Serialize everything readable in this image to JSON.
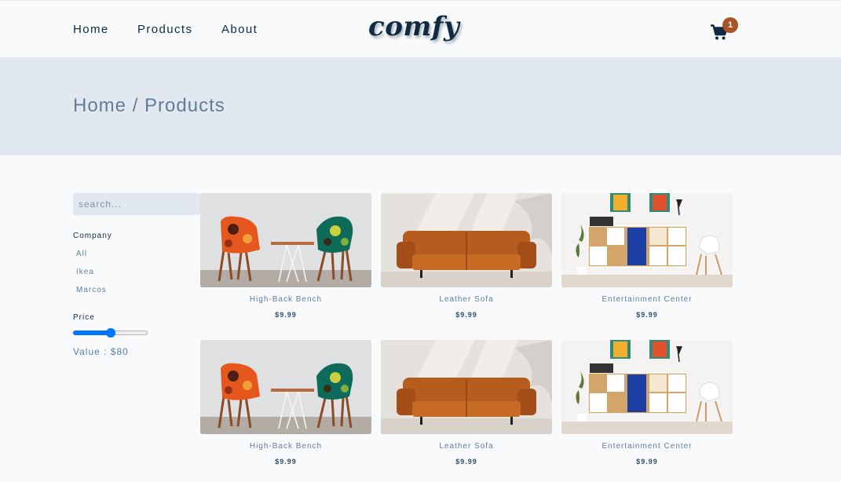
{
  "nav": {
    "links": [
      "Home",
      "Products",
      "About"
    ],
    "logo": "comfy",
    "cart_count": "1"
  },
  "hero": {
    "breadcrumb": "Home / Products"
  },
  "filters": {
    "search_placeholder": "search...",
    "company_heading": "Company",
    "companies": [
      "All",
      "Ikea",
      "Marcos"
    ],
    "price_heading": "Price",
    "price_label": "Value : $80",
    "price_slider_fraction": 0.5
  },
  "products": [
    {
      "name": "High-Back Bench",
      "price": "$9.99",
      "image": "chairs-image"
    },
    {
      "name": "Leather Sofa",
      "price": "$9.99",
      "image": "sofa-image"
    },
    {
      "name": "Entertainment Center",
      "price": "$9.99",
      "image": "cabinet-image"
    },
    {
      "name": "High-Back Bench",
      "price": "$9.99",
      "image": "chairs-image"
    },
    {
      "name": "Leather Sofa",
      "price": "$9.99",
      "image": "sofa-image"
    },
    {
      "name": "Entertainment Center",
      "price": "$9.99",
      "image": "cabinet-image"
    }
  ],
  "colors": {
    "accent": "#ab5326",
    "primary_text": "#102a42",
    "muted_text": "#617d98",
    "hero_bg": "#e2e8f0",
    "slider": "#0075ff"
  },
  "icons": {
    "cart": "shopping-cart-icon"
  }
}
